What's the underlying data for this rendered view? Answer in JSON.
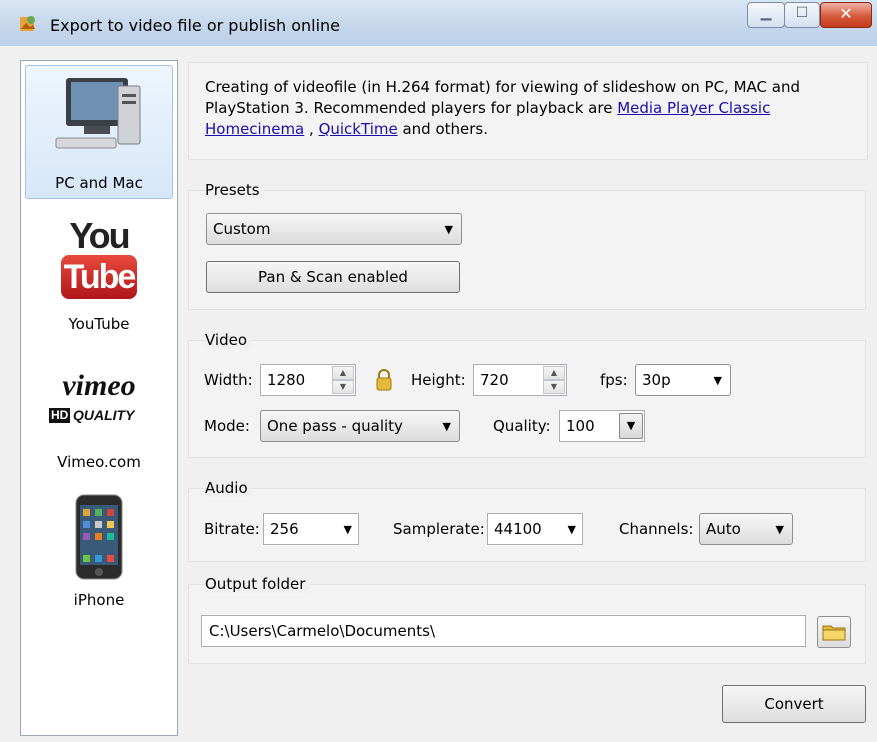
{
  "window": {
    "title": "Export to video file or publish online"
  },
  "sidebar": {
    "items": [
      {
        "label": "PC and Mac",
        "icon": "pc-icon"
      },
      {
        "label": "YouTube",
        "icon": "youtube-logo",
        "logo_top": "You",
        "logo_bottom": "Tube"
      },
      {
        "label": "Vimeo.com",
        "icon": "vimeo-logo",
        "logo_word": "vimeo",
        "logo_badge": "HD",
        "logo_quality": "QUALITY"
      },
      {
        "label": "iPhone",
        "icon": "iphone-icon"
      }
    ]
  },
  "description": {
    "text_before": "Creating of videofile (in H.264 format) for viewing of slideshow on PC, MAC and PlayStation 3. Recommended players for playback are ",
    "link1": "Media Player Classic Homecinema",
    "separator": " , ",
    "link2": "QuickTime",
    "text_after": " and others."
  },
  "presets": {
    "title": "Presets",
    "selected": "Custom",
    "pan_scan_label": "Pan & Scan enabled"
  },
  "video": {
    "title": "Video",
    "width_label": "Width:",
    "width_value": "1280",
    "height_label": "Height:",
    "height_value": "720",
    "fps_label": "fps:",
    "fps_value": "30p",
    "mode_label": "Mode:",
    "mode_value": "One pass - quality",
    "quality_label": "Quality:",
    "quality_value": "100"
  },
  "audio": {
    "title": "Audio",
    "bitrate_label": "Bitrate:",
    "bitrate_value": "256",
    "samplerate_label": "Samplerate:",
    "samplerate_value": "44100",
    "channels_label": "Channels:",
    "channels_value": "Auto"
  },
  "output": {
    "title": "Output folder",
    "path": "C:\\Users\\Carmelo\\Documents\\"
  },
  "convert_label": "Convert",
  "colors": {
    "link": "#1a0dab",
    "selection": "#d7e7f9",
    "youtube_red": "#cc1f1f"
  }
}
